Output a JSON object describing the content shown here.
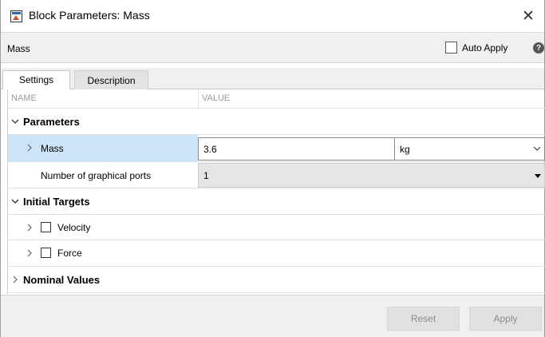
{
  "window": {
    "title": "Block Parameters: Mass",
    "close_glyph": "✕"
  },
  "header": {
    "block_name": "Mass",
    "auto_apply_label": "Auto Apply",
    "help_glyph": "?"
  },
  "tabs": [
    {
      "label": "Settings",
      "selected": true
    },
    {
      "label": "Description",
      "selected": false
    }
  ],
  "columns": {
    "name": "NAME",
    "value": "VALUE"
  },
  "parameters_section": {
    "label": "Parameters",
    "mass": {
      "label": "Mass",
      "value": "3.6",
      "unit": "kg"
    },
    "graphical_ports": {
      "label": "Number of graphical ports",
      "value": "1"
    }
  },
  "initial_targets_section": {
    "label": "Initial Targets",
    "velocity": {
      "label": "Velocity",
      "checked": false
    },
    "force": {
      "label": "Force",
      "checked": false
    }
  },
  "nominal_values_section": {
    "label": "Nominal Values"
  },
  "footer": {
    "reset_label": "Reset",
    "apply_label": "Apply"
  },
  "icons": {
    "window_icon": "block-parameters-icon",
    "expand_open": "chevron-down-icon",
    "expand_closed": "chevron-right-icon",
    "help": "help-icon"
  },
  "colors": {
    "selection": "#cce4f7",
    "disabled_text": "#8c8c8c",
    "panel": "#f0f0f0"
  }
}
